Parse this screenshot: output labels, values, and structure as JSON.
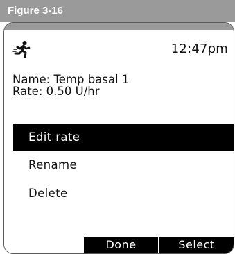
{
  "figure": {
    "label": "Figure 3-16"
  },
  "status": {
    "icon": "running-person-icon",
    "time": "12:47pm"
  },
  "info": {
    "name_line": "Name: Temp basal 1",
    "rate_line": "Rate: 0.50 U/hr"
  },
  "menu": {
    "items": [
      {
        "label": "Edit rate",
        "selected": true
      },
      {
        "label": "Rename",
        "selected": false
      },
      {
        "label": "Delete",
        "selected": false
      }
    ]
  },
  "softkeys": {
    "left": "Done",
    "right": "Select"
  },
  "colors": {
    "header_gray": "#9a9a9a",
    "highlight": "#000000"
  }
}
